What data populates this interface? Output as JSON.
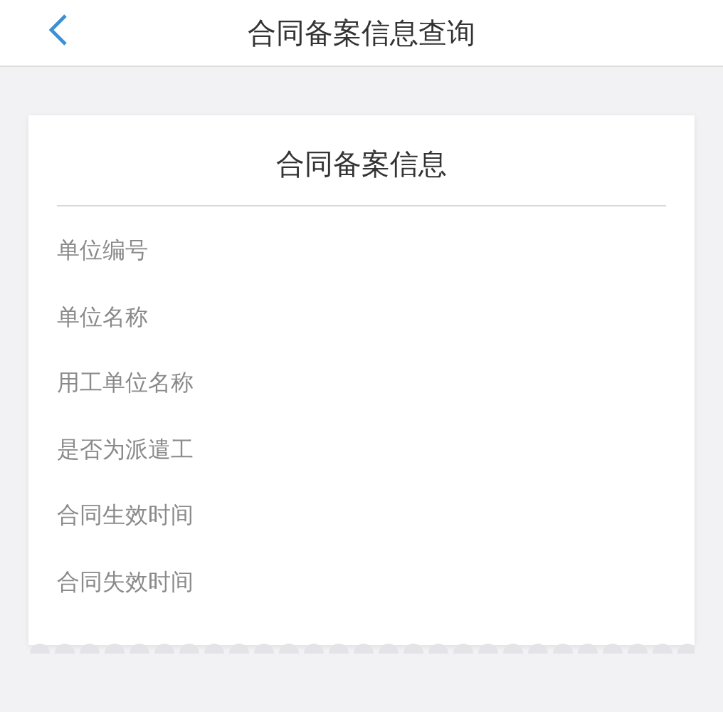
{
  "header": {
    "title": "合同备案信息查询"
  },
  "card": {
    "title": "合同备案信息",
    "fields": [
      {
        "label": "单位编号"
      },
      {
        "label": "单位名称"
      },
      {
        "label": "用工单位名称"
      },
      {
        "label": "是否为派遣工"
      },
      {
        "label": "合同生效时间"
      },
      {
        "label": "合同失效时间"
      }
    ]
  }
}
